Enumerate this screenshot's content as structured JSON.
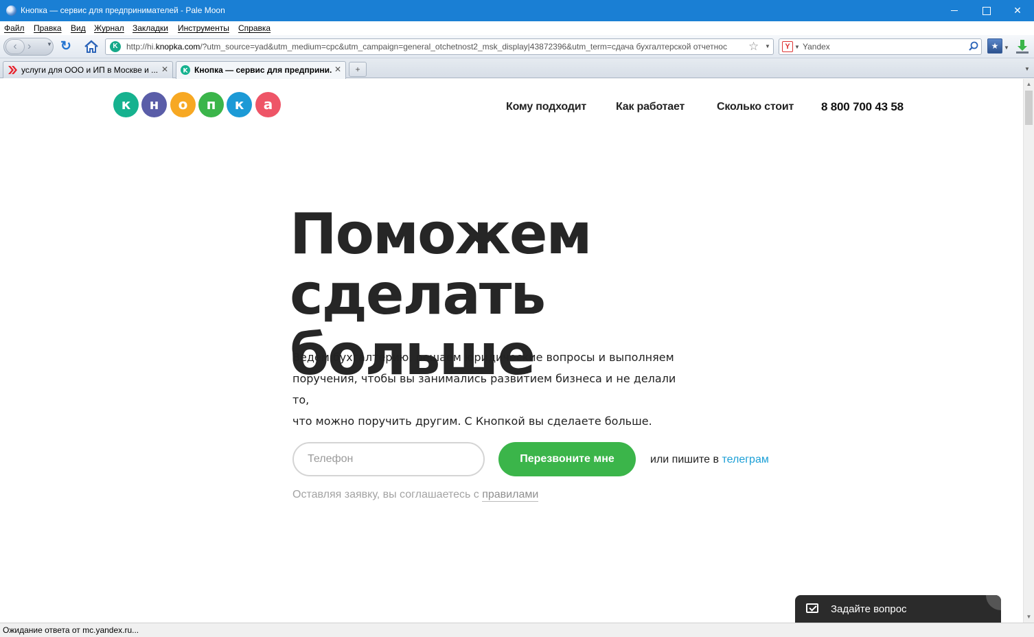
{
  "window": {
    "title": "Кнопка — сервис для предпринимателей - Pale Moon",
    "minimize": "—",
    "maximize": "☐",
    "close": "✕"
  },
  "menu": [
    "Файл",
    "Правка",
    "Вид",
    "Журнал",
    "Закладки",
    "Инструменты",
    "Справка"
  ],
  "toolbar": {
    "url_prefix": "http://hi.",
    "url_domain": "knopka.com",
    "url_rest": "/?utm_source=yad&utm_medium=cpc&utm_campaign=general_otchetnost2_msk_display|43872396&utm_term=сдача бухгалтерской отчетнос",
    "search_engine_letter": "Y",
    "search_value": "Yandex"
  },
  "tabs": [
    {
      "label": "услуги для ООО и ИП в Москве и ...",
      "active": false
    },
    {
      "label": "Кнопка — сервис для предприни...",
      "active": true
    }
  ],
  "site": {
    "logo_letters": [
      {
        "ch": "к",
        "color": "#16b28f"
      },
      {
        "ch": "н",
        "color": "#5a5da8"
      },
      {
        "ch": "о",
        "color": "#f7a823"
      },
      {
        "ch": "п",
        "color": "#3bb54a"
      },
      {
        "ch": "к",
        "color": "#1c9ad6"
      },
      {
        "ch": "а",
        "color": "#ee5567"
      }
    ],
    "nav": {
      "who": "Кому подходит",
      "how": "Как работает",
      "price": "Сколько стоит",
      "phone": "8 800 700 43 58"
    },
    "hero": {
      "title_line1": "Поможем",
      "title_line2": "сделать больше",
      "desc_line1": "Ведём бухгалтерию, решаем юридические вопросы и выполняем",
      "desc_line2": "поручения, чтобы вы занимались развитием бизнеса и не делали то,",
      "desc_line3": "что можно поручить другим. С Кнопкой вы сделаете больше."
    },
    "form": {
      "phone_placeholder": "Телефон",
      "button": "Перезвоните мне",
      "or_write": "или пишите в ",
      "telegram": "телеграм",
      "consent": "Оставляя заявку, вы соглашаетесь с ",
      "rules": "правилами"
    },
    "chat": {
      "label": "Задайте вопрос"
    }
  },
  "status": "Ожидание ответа от mc.yandex.ru..."
}
